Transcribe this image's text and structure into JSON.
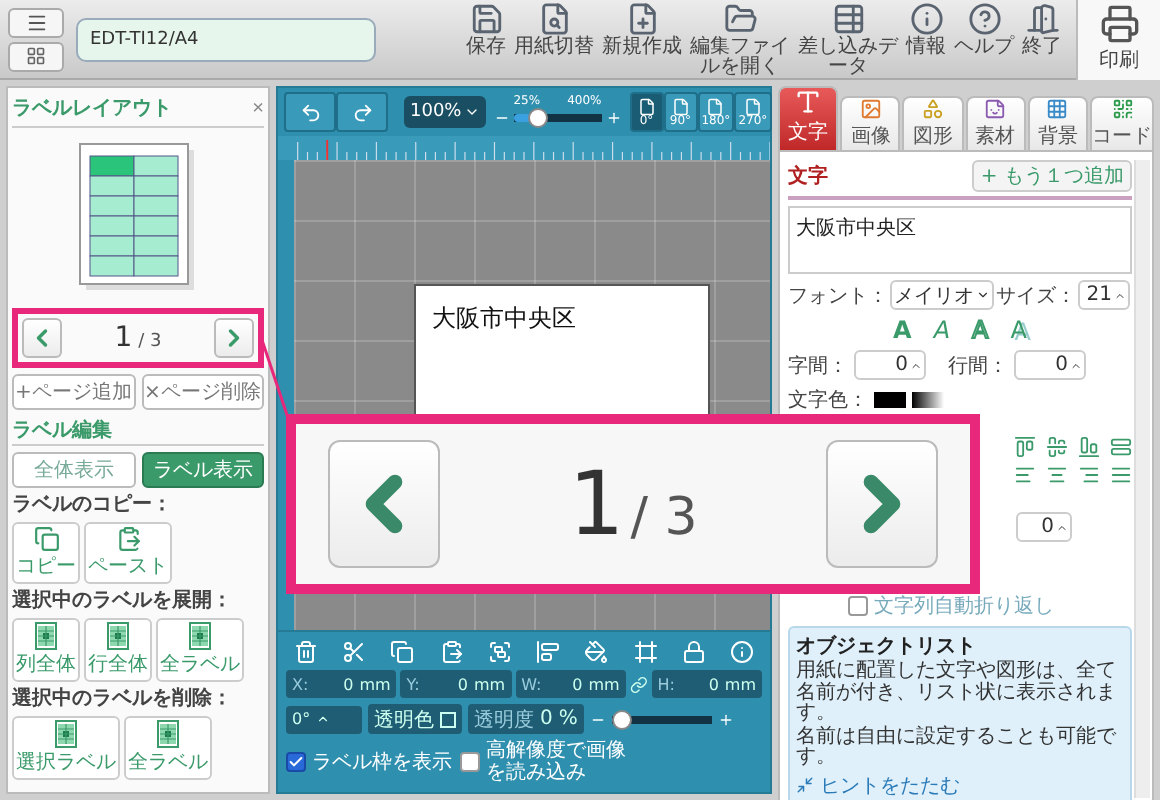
{
  "top_bar": {
    "filename": "EDT-TI12/A4",
    "tools": [
      {
        "kind": "save",
        "label": "保存"
      },
      {
        "kind": "paper",
        "label": "用紙切替"
      },
      {
        "kind": "new",
        "label": "新規作成"
      },
      {
        "kind": "open",
        "label": "編集ファイルを開く"
      },
      {
        "kind": "merge",
        "label": "差し込みデータ"
      },
      {
        "kind": "info",
        "label": "情報"
      },
      {
        "kind": "help",
        "label": "ヘルプ"
      },
      {
        "kind": "exit",
        "label": "終了"
      }
    ],
    "print": "印刷"
  },
  "left_panel": {
    "title": "ラベルレイアウト",
    "close": "×",
    "pager": {
      "current": "1",
      "total": "/ 3"
    },
    "page_buttons": [
      {
        "icon": "+",
        "label": "ページ追加"
      },
      {
        "icon": "×",
        "label": "ページ削除"
      }
    ],
    "edit_title": "ラベル編集",
    "view_toggle": [
      {
        "label": "全体表示",
        "selected": false
      },
      {
        "label": "ラベル表示",
        "selected": true
      }
    ],
    "sections": [
      {
        "heading": "ラベルのコピー：",
        "buttons": [
          {
            "kind": "copy",
            "label": "コピー"
          },
          {
            "kind": "paste",
            "label": "ペースト"
          }
        ]
      },
      {
        "heading": "選択中のラベルを展開：",
        "buttons": [
          {
            "kind": "sheet",
            "label": "列全体"
          },
          {
            "kind": "sheet",
            "label": "行全体"
          },
          {
            "kind": "sheet",
            "label": "全ラベル"
          }
        ]
      },
      {
        "heading": "選択中のラベルを削除：",
        "buttons": [
          {
            "kind": "sheet",
            "label": "選択ラベル"
          },
          {
            "kind": "sheet",
            "label": "全ラベル"
          }
        ]
      }
    ]
  },
  "canvas": {
    "zoom": "100%",
    "zoom_min": "25%",
    "zoom_max": "400%",
    "zoom_slider": {
      "level": 0.2
    },
    "rotations": [
      {
        "label": "0°",
        "selected": true
      },
      {
        "label": "90°",
        "selected": false
      },
      {
        "label": "180°",
        "selected": false
      },
      {
        "label": "270°",
        "selected": false
      }
    ],
    "label_text": "大阪市中央区"
  },
  "bottom_panel": {
    "tools": [
      {
        "kind": "delete"
      },
      {
        "kind": "cut"
      },
      {
        "kind": "copy"
      },
      {
        "kind": "paste"
      },
      {
        "kind": "arrange"
      },
      {
        "kind": "align"
      },
      {
        "kind": "fill"
      },
      {
        "kind": "frame"
      },
      {
        "kind": "lock"
      },
      {
        "kind": "info"
      }
    ],
    "fields": [
      {
        "label": "X:",
        "value": "0",
        "unit": "mm"
      },
      {
        "label": "Y:",
        "value": "0",
        "unit": "mm"
      },
      {
        "label": "W:",
        "value": "0",
        "unit": "mm"
      },
      {
        "label": "H:",
        "value": "0",
        "unit": "mm"
      }
    ],
    "angle": "0°",
    "transparent_color": "透明色",
    "opacity": {
      "label": "透明度",
      "value": "0",
      "unit": "%",
      "level": 0.0
    },
    "checkboxes": [
      {
        "label": "ラベル枠を表示",
        "checked": true
      },
      {
        "label": "高解像度で画像を読み込み",
        "checked": false
      }
    ]
  },
  "right_panel": {
    "tabs": [
      {
        "kind": "text",
        "label": "文字",
        "selected": true
      },
      {
        "kind": "image",
        "label": "画像",
        "selected": false
      },
      {
        "kind": "shape",
        "label": "図形",
        "selected": false
      },
      {
        "kind": "material",
        "label": "素材",
        "selected": false
      },
      {
        "kind": "background",
        "label": "背景",
        "selected": false
      },
      {
        "kind": "code",
        "label": "コード",
        "selected": false
      }
    ],
    "section_title": "文字",
    "add_button": {
      "icon": "+",
      "label": "もう１つ追加"
    },
    "text_value": "大阪市中央区",
    "font_label": "フォント：",
    "font": "メイリオ",
    "size_label": "サイズ：",
    "size": "21",
    "styles": [
      {
        "kind": "bold",
        "glyph": "A"
      },
      {
        "kind": "italic",
        "glyph": "A"
      },
      {
        "kind": "outline",
        "glyph": "A"
      },
      {
        "kind": "shadow",
        "glyph": "A"
      }
    ],
    "char_spacing_label": "字間：",
    "char_spacing": "0",
    "line_spacing_label": "行間：",
    "line_spacing": "0",
    "color_label": "文字色：",
    "swatches": [
      {
        "kind": "solid",
        "color": "#000000"
      },
      {
        "kind": "gradient"
      }
    ],
    "extra_value": "0",
    "wrap_checkbox": {
      "label": "文字列自動折り返し",
      "checked": false
    },
    "hint": {
      "title": "オブジェクトリスト",
      "paragraphs": [
        "用紙に配置した文字や図形は、全て名前が付き、リスト状に表示されます。",
        "名前は自由に設定することも可能です。"
      ],
      "link": "ヒントをたたむ"
    }
  },
  "callout": {
    "current": "1",
    "total": "/ 3"
  }
}
